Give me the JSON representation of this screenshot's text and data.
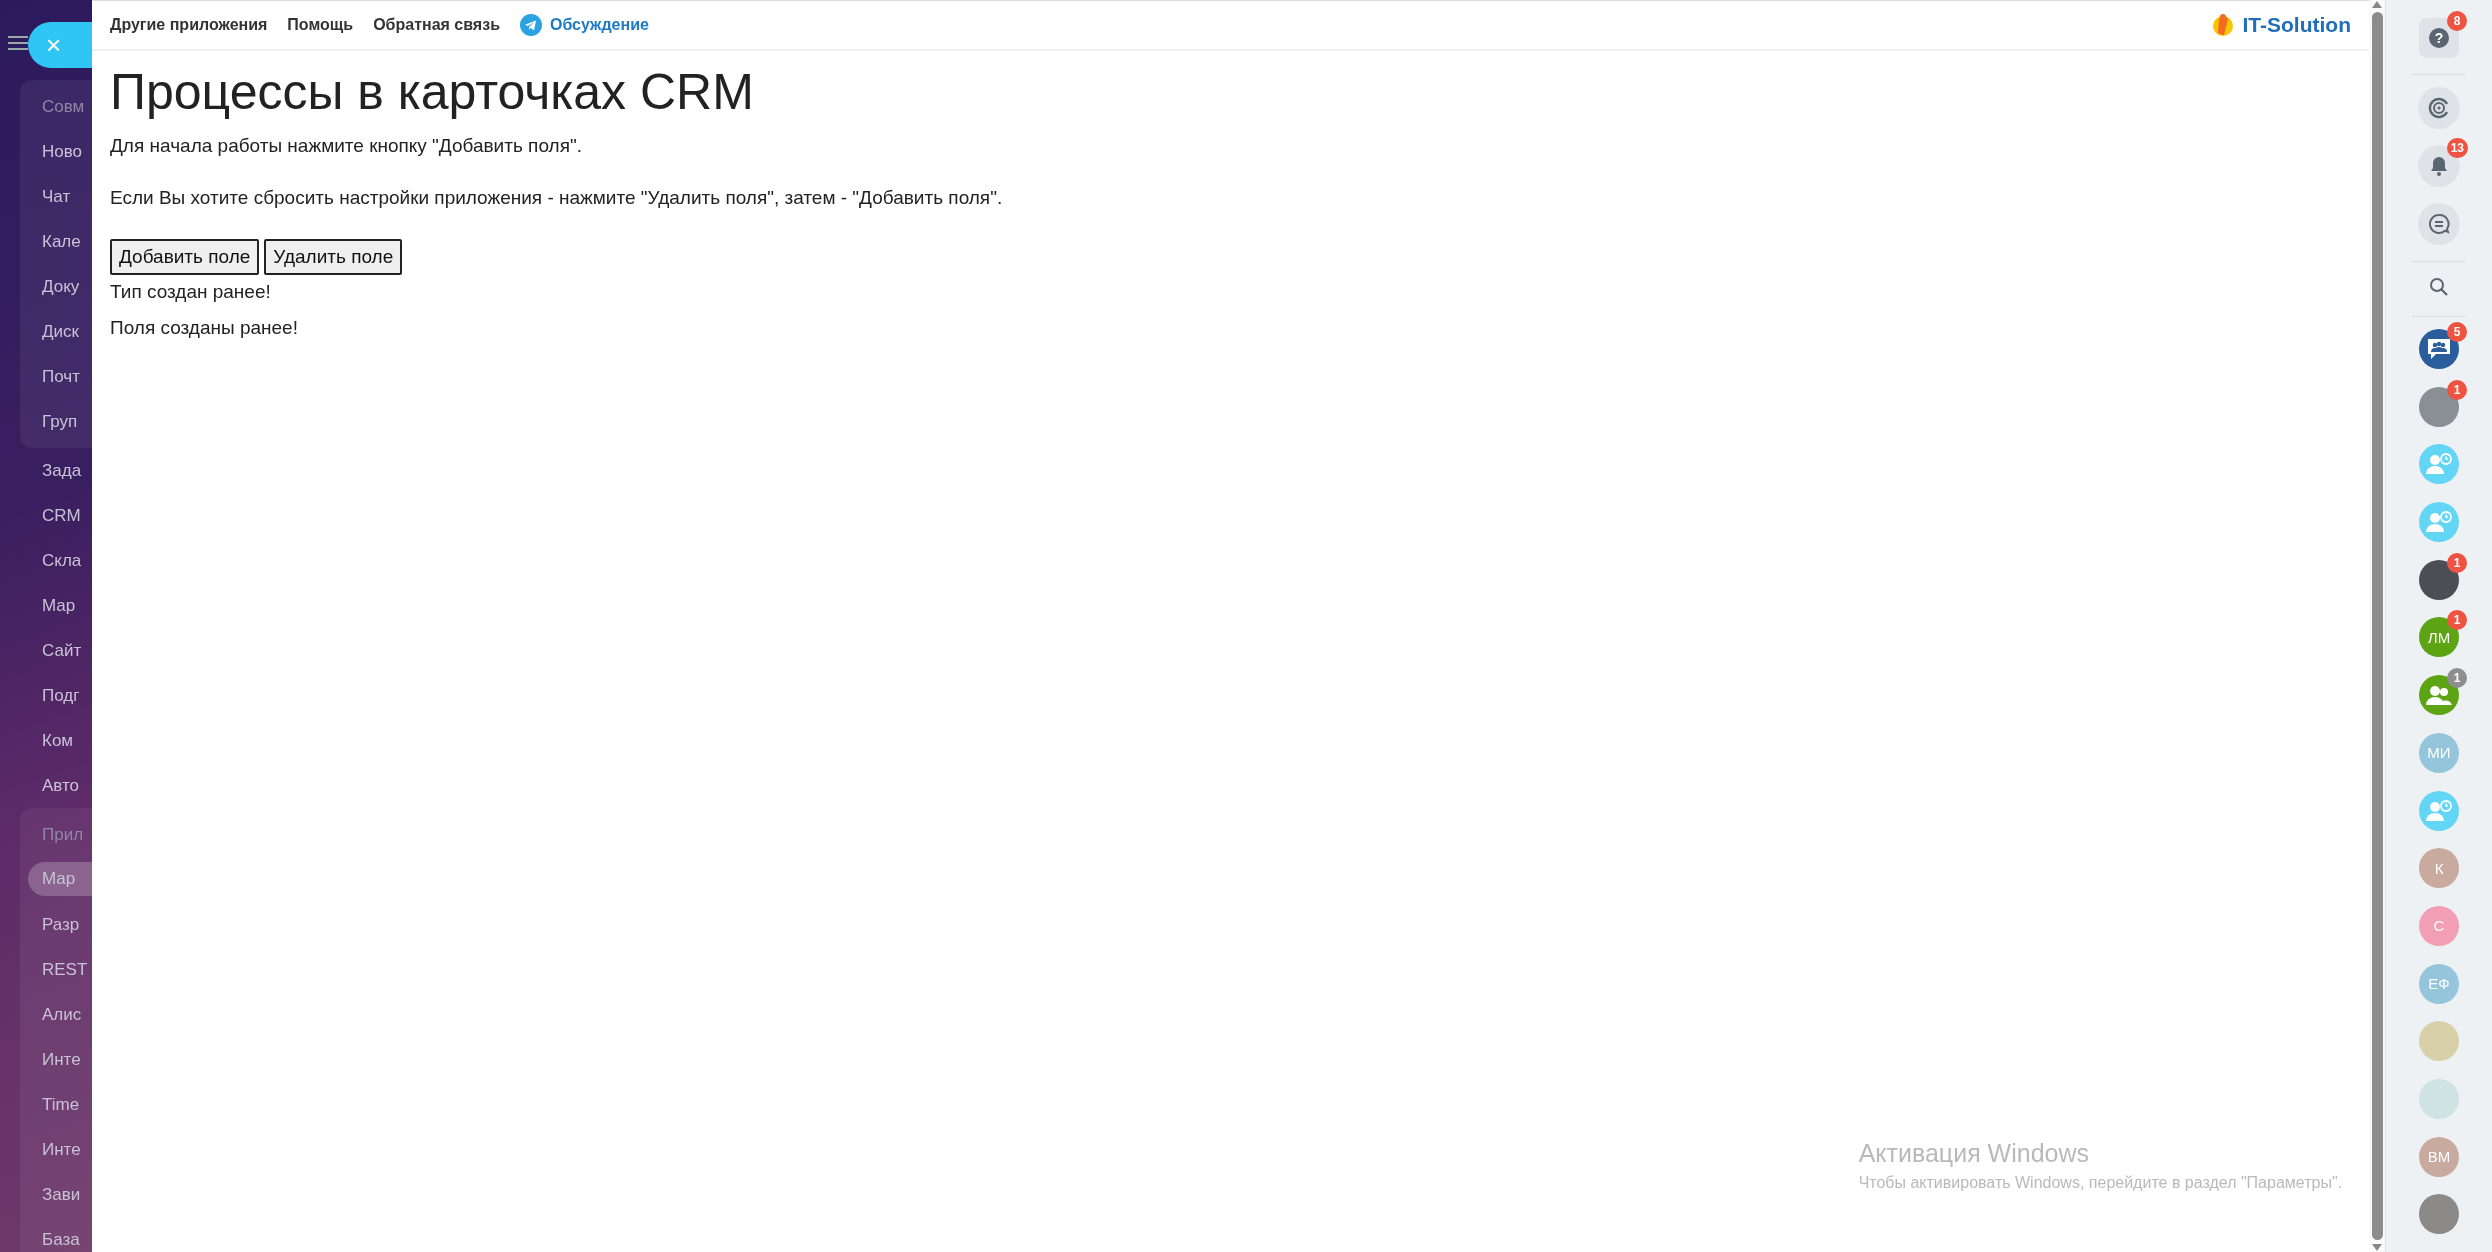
{
  "left_menu": {
    "close_label": "×",
    "items": [
      {
        "label": "Совм",
        "kind": "heading",
        "selected": false
      },
      {
        "label": "Ново",
        "kind": "item",
        "selected": false
      },
      {
        "label": "Чат",
        "kind": "item",
        "selected": false
      },
      {
        "label": "Кале",
        "kind": "item",
        "selected": false
      },
      {
        "label": "Доку",
        "kind": "item",
        "selected": false
      },
      {
        "label": "Диск",
        "kind": "item",
        "selected": false
      },
      {
        "label": "Почт",
        "kind": "item",
        "selected": false
      },
      {
        "label": "Груп",
        "kind": "item",
        "selected": false
      },
      {
        "label": "Зада",
        "kind": "loose",
        "selected": false
      },
      {
        "label": "CRM",
        "kind": "loose",
        "selected": false
      },
      {
        "label": "Скла",
        "kind": "loose",
        "selected": false
      },
      {
        "label": "Мар",
        "kind": "loose",
        "selected": false
      },
      {
        "label": "Сайт",
        "kind": "loose",
        "selected": false
      },
      {
        "label": "Подг",
        "kind": "loose",
        "selected": false
      },
      {
        "label": "Ком",
        "kind": "loose",
        "selected": false
      },
      {
        "label": "Авто",
        "kind": "loose",
        "selected": false
      },
      {
        "label": "Прил",
        "kind": "heading",
        "selected": false
      },
      {
        "label": "Мар",
        "kind": "item",
        "selected": true
      },
      {
        "label": "Разр",
        "kind": "item",
        "selected": false
      },
      {
        "label": "REST",
        "kind": "item",
        "selected": false
      },
      {
        "label": "Алис",
        "kind": "item",
        "selected": false
      },
      {
        "label": "Инте",
        "kind": "item",
        "selected": false
      },
      {
        "label": "Time",
        "kind": "item",
        "selected": false
      },
      {
        "label": "Инте",
        "kind": "item",
        "selected": false
      },
      {
        "label": "Зави",
        "kind": "item",
        "selected": false
      },
      {
        "label": "База",
        "kind": "item",
        "selected": false
      }
    ]
  },
  "top_bar": {
    "links": [
      {
        "label": "Другие приложения",
        "kind": "plain"
      },
      {
        "label": "Помощь",
        "kind": "plain"
      },
      {
        "label": "Обратная связь",
        "kind": "plain"
      },
      {
        "label": "Обсуждение",
        "kind": "telegram"
      }
    ],
    "brand": "IT-Solution"
  },
  "page": {
    "title": "Процессы в карточках CRM",
    "paragraphs": [
      "Для начала работы нажмите кнопку \"Добавить поля\".",
      "Если Вы хотите сбросить настройки приложения - нажмите \"Удалить поля\", затем - \"Добавить поля\"."
    ],
    "buttons": [
      "Добавить поле",
      "Удалить поле"
    ],
    "messages": [
      "Тип создан ранее!",
      "Поля созданы ранее!"
    ]
  },
  "right_panel": {
    "tools": [
      {
        "kind": "help",
        "badge": "8",
        "icon_text": "?"
      },
      {
        "kind": "divider"
      },
      {
        "kind": "copilot"
      },
      {
        "kind": "bell",
        "badge": "13"
      },
      {
        "kind": "chats"
      },
      {
        "kind": "divider"
      },
      {
        "kind": "search"
      },
      {
        "kind": "divider"
      }
    ],
    "contacts": [
      {
        "kind": "group-chat",
        "color": "#2a5d9c",
        "badge": "5",
        "muted": false
      },
      {
        "kind": "photo",
        "color": "#8a8f96",
        "badge": "1",
        "muted": false
      },
      {
        "kind": "waiting-user",
        "color": "#64d6f5"
      },
      {
        "kind": "waiting-user",
        "color": "#64d6f5"
      },
      {
        "kind": "photo",
        "color": "#4b4f55",
        "badge": "1",
        "muted": false
      },
      {
        "kind": "initials",
        "initials": "ЛМ",
        "color": "#5da415",
        "badge": "1",
        "muted": false
      },
      {
        "kind": "group",
        "color": "#5da415",
        "badge": "1",
        "muted": true
      },
      {
        "kind": "initials",
        "initials": "МИ",
        "color": "#95c5da"
      },
      {
        "kind": "waiting-user",
        "color": "#64d6f5"
      },
      {
        "kind": "initials",
        "initials": "К",
        "color": "#c8aa9e"
      },
      {
        "kind": "initials",
        "initials": "С",
        "color": "#f29eb5"
      },
      {
        "kind": "initials",
        "initials": "ЕФ",
        "color": "#95c5da"
      },
      {
        "kind": "photo",
        "color": "#d8d0a8"
      },
      {
        "kind": "photo",
        "color": "#cfe3e2"
      },
      {
        "kind": "initials",
        "initials": "ВМ",
        "color": "#c8aa9e"
      },
      {
        "kind": "photo",
        "color": "#8c8a88"
      }
    ]
  },
  "os_notice": {
    "title": "Активация Windows",
    "text": "Чтобы активировать Windows, перейдите в раздел \"Параметры\"."
  }
}
